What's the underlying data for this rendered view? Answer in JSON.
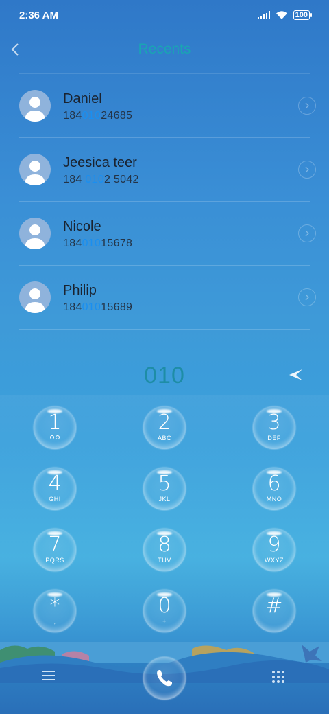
{
  "status_bar": {
    "time": "2:36 AM",
    "battery": "100",
    "icons": [
      "signal-icon",
      "wifi-icon",
      "battery-icon"
    ]
  },
  "header": {
    "title": "Recents",
    "back_icon": "chevron-left-icon"
  },
  "recents": [
    {
      "name": "Daniel",
      "number_prefix": "184",
      "number_match": "010",
      "number_suffix": "24685"
    },
    {
      "name": "Jeesica teer",
      "number_prefix": "184 ",
      "number_match": "010",
      "number_suffix": "2 5042"
    },
    {
      "name": "Nicole",
      "number_prefix": "184",
      "number_match": "010",
      "number_suffix": "15678"
    },
    {
      "name": "Philip",
      "number_prefix": "184",
      "number_match": "010",
      "number_suffix": "15689"
    }
  ],
  "dial_input": {
    "value": "010",
    "backspace_icon": "backspace-icon"
  },
  "keypad": {
    "keys": [
      {
        "digit": "1",
        "sub": "voicemail-icon"
      },
      {
        "digit": "2",
        "sub": "ABC"
      },
      {
        "digit": "3",
        "sub": "DEF"
      },
      {
        "digit": "4",
        "sub": "GHI"
      },
      {
        "digit": "5",
        "sub": "JKL"
      },
      {
        "digit": "6",
        "sub": "MNO"
      },
      {
        "digit": "7",
        "sub": "PQRS"
      },
      {
        "digit": "8",
        "sub": "TUV"
      },
      {
        "digit": "9",
        "sub": "WXYZ"
      },
      {
        "digit": "*",
        "sub": ","
      },
      {
        "digit": "0",
        "sub": "+"
      },
      {
        "digit": "#",
        "sub": ""
      }
    ]
  },
  "bottom_bar": {
    "menu_icon": "menu-icon",
    "call_icon": "phone-icon",
    "dialpad_icon": "dialpad-icon"
  },
  "colors": {
    "accent": "#1aa4b4",
    "match_highlight": "#1a8ff0",
    "dial_text": "#1e8da6"
  }
}
